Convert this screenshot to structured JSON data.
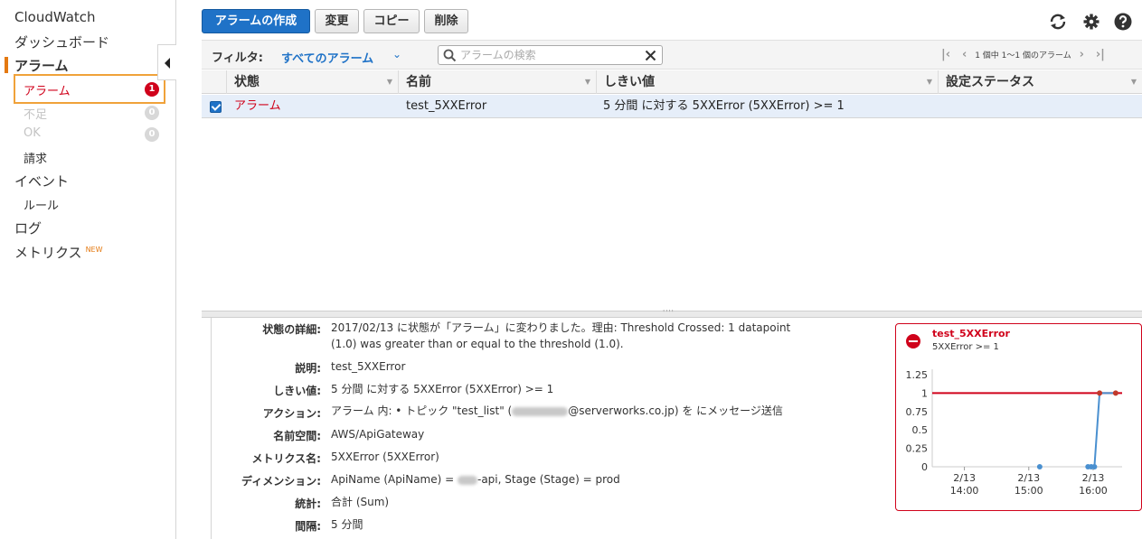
{
  "sidebar": {
    "title": "CloudWatch",
    "items": {
      "dashboard": "ダッシュボード",
      "alarms": "アラーム",
      "alarm_state": "アラーム",
      "alarm_count": "1",
      "insufficient": "不足",
      "insufficient_count": "0",
      "ok": "OK",
      "ok_count": "0",
      "billing": "請求",
      "events": "イベント",
      "rules": "ルール",
      "logs": "ログ",
      "metrics": "メトリクス",
      "metrics_badge": "NEW"
    }
  },
  "toolbar": {
    "create": "アラームの作成",
    "modify": "変更",
    "copy": "コピー",
    "delete": "削除",
    "icons": [
      "refresh-icon",
      "gear-icon",
      "help-icon"
    ]
  },
  "filter": {
    "label": "フィルタ:",
    "value": "すべてのアラーム",
    "search_placeholder": "アラームの検索",
    "pager_text": "1 個中 1〜1 個のアラーム"
  },
  "table": {
    "columns": [
      "状態",
      "名前",
      "しきい値",
      "設定ステータス"
    ],
    "rows": [
      {
        "state": "アラーム",
        "name": "test_5XXError",
        "threshold": "5 分間 に対する 5XXError (5XXError) >= 1",
        "config_status": ""
      }
    ]
  },
  "details": {
    "state_detail_label": "状態の詳細:",
    "state_detail_line1": "2017/02/13 に状態が「アラーム」に変わりました。理由: Threshold Crossed: 1 datapoint",
    "state_detail_line2": "(1.0) was greater than or equal to the threshold (1.0).",
    "description_label": "説明:",
    "description": "test_5XXError",
    "threshold_label": "しきい値:",
    "threshold": "5 分間 に対する 5XXError (5XXError) >= 1",
    "actions_label": "アクション:",
    "actions_prefix": "アラーム 内:  •  トピック \"test_list\" (",
    "actions_suffix": "@serverworks.co.jp) を にメッセージ送信",
    "namespace_label": "名前空間:",
    "namespace": "AWS/ApiGateway",
    "metric_label": "メトリクス名:",
    "metric": "5XXError (5XXError)",
    "dimension_label": "ディメンション:",
    "dimension_prefix": "ApiName (ApiName) = ",
    "dimension_suffix": "-api, Stage (Stage) = prod",
    "statistic_label": "統計:",
    "statistic": "合計 (Sum)",
    "period_label": "間隔:",
    "period": "5 分間"
  },
  "card": {
    "title": "test_5XXError",
    "subtitle": "5XXError >= 1",
    "accent": "#d0021b"
  },
  "chart_data": {
    "type": "line",
    "title": "test_5XXError",
    "subtitle": "5XXError >= 1",
    "x_tick_labels": [
      [
        "2/13",
        "14:00"
      ],
      [
        "2/13",
        "15:00"
      ],
      [
        "2/13",
        "16:00"
      ]
    ],
    "x_tick_hours": [
      14,
      15,
      16
    ],
    "xlim_hours": [
      13.5,
      16.45
    ],
    "ylim": [
      0,
      1.25
    ],
    "y_ticks": [
      "0",
      "0.25",
      "0.5",
      "0.75",
      "1",
      "1.25"
    ],
    "threshold": 1,
    "threshold_color": "#d0021b",
    "series": [
      {
        "color": "#4a90d0",
        "points": [
          {
            "x": 15.17,
            "y": 0
          },
          {
            "x": 15.92,
            "y": 0
          },
          {
            "x": 15.97,
            "y": 0
          },
          {
            "x": 16.02,
            "y": 0
          },
          {
            "x": 16.1,
            "y": 1
          },
          {
            "x": 16.35,
            "y": 1
          }
        ]
      }
    ],
    "grid": false
  }
}
